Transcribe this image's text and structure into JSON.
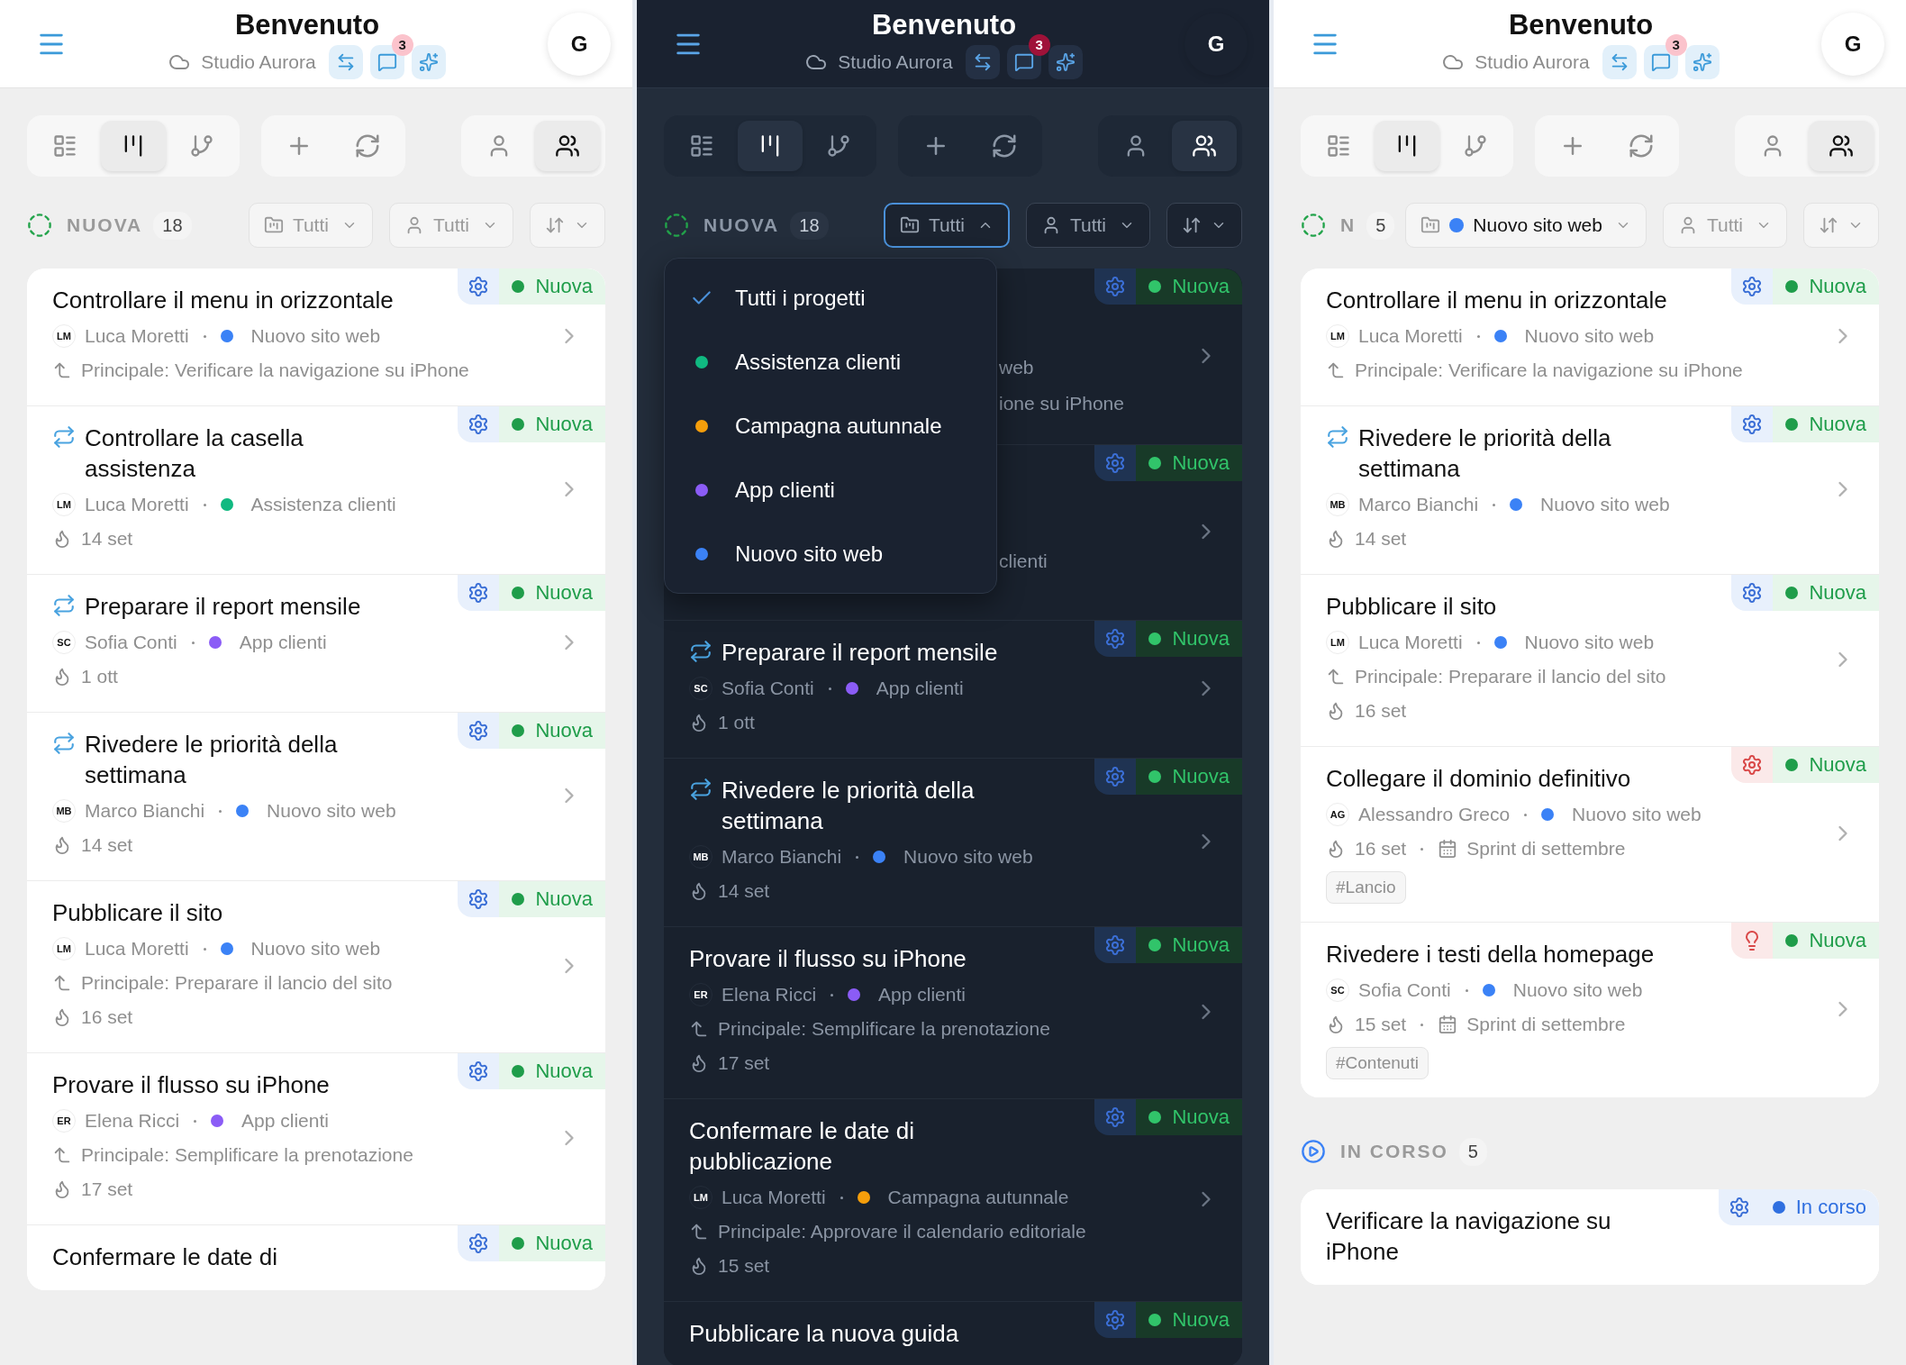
{
  "panels": [
    {
      "kind": "light",
      "header": {
        "title": "Benvenuto",
        "workspace": "Studio Aurora",
        "badge": "3",
        "avatar": "G"
      },
      "toolbar": {
        "views": [
          {
            "kind": "list",
            "selected": false
          },
          {
            "kind": "board",
            "selected": true
          },
          {
            "kind": "branch",
            "selected": false
          }
        ],
        "actions": [
          {
            "kind": "add"
          },
          {
            "kind": "refresh"
          }
        ],
        "scopes": [
          {
            "kind": "me",
            "selected": false
          },
          {
            "kind": "team",
            "selected": true
          }
        ]
      },
      "filters": {
        "project": {
          "label": "Tutti",
          "open": false
        },
        "assignee": {
          "label": "Tutti"
        }
      },
      "sections": [
        {
          "kind": "new",
          "label": "NUOVA",
          "count": "18",
          "cards": [
            {
              "kind": "task",
              "title": "Controllare il menu in orizzontale",
              "recurring": false,
              "initials": "LM",
              "assignee": "Luca Moretti",
              "project": "Nuovo sito web",
              "color": "#3b82f6",
              "parent": "Principale: Verificare la navigazione su iPhone",
              "type": {
                "kind": "gear",
                "urgent": false
              },
              "status": "Nuova"
            },
            {
              "kind": "task",
              "title": "Controllare la casella assistenza",
              "recurring": true,
              "initials": "LM",
              "assignee": "Luca Moretti",
              "project": "Assistenza clienti",
              "color": "#10b981",
              "due": "14 set",
              "type": {
                "kind": "gear",
                "urgent": false
              },
              "status": "Nuova"
            },
            {
              "kind": "task",
              "title": "Preparare il report mensile",
              "recurring": true,
              "initials": "SC",
              "assignee": "Sofia Conti",
              "project": "App clienti",
              "color": "#8b5cf6",
              "due": "1 ott",
              "type": {
                "kind": "gear",
                "urgent": false
              },
              "status": "Nuova"
            },
            {
              "kind": "task",
              "title": "Rivedere le priorità della settimana",
              "recurring": true,
              "initials": "MB",
              "assignee": "Marco Bianchi",
              "project": "Nuovo sito web",
              "color": "#3b82f6",
              "due": "14 set",
              "type": {
                "kind": "gear",
                "urgent": false
              },
              "status": "Nuova"
            },
            {
              "kind": "task",
              "title": "Pubblicare il sito",
              "recurring": false,
              "initials": "LM",
              "assignee": "Luca Moretti",
              "project": "Nuovo sito web",
              "color": "#3b82f6",
              "parent": "Principale: Preparare il lancio del sito",
              "due": "16 set",
              "type": {
                "kind": "gear",
                "urgent": false
              },
              "status": "Nuova"
            },
            {
              "kind": "task",
              "title": "Provare il flusso su iPhone",
              "recurring": false,
              "initials": "ER",
              "assignee": "Elena Ricci",
              "project": "App clienti",
              "color": "#8b5cf6",
              "parent": "Principale: Semplificare la prenotazione",
              "due": "17 set",
              "type": {
                "kind": "gear",
                "urgent": false
              },
              "status": "Nuova"
            },
            {
              "kind": "task",
              "title": "Confermare le date di",
              "recurring": false,
              "type": {
                "kind": "gear",
                "urgent": false
              },
              "status": "Nuova"
            }
          ]
        }
      ]
    },
    {
      "kind": "dark",
      "header": {
        "title": "Benvenuto",
        "workspace": "Studio Aurora",
        "badge": "3",
        "avatar": "G"
      },
      "toolbar": {
        "views": [
          {
            "kind": "list",
            "selected": false
          },
          {
            "kind": "board",
            "selected": true
          },
          {
            "kind": "branch",
            "selected": false
          }
        ],
        "actions": [
          {
            "kind": "add"
          },
          {
            "kind": "refresh"
          }
        ],
        "scopes": [
          {
            "kind": "me",
            "selected": false
          },
          {
            "kind": "team",
            "selected": true
          }
        ]
      },
      "filters": {
        "project": {
          "label": "Tutti",
          "open": true
        },
        "assignee": {
          "label": "Tutti"
        }
      },
      "project_menu": [
        {
          "label": "Tutti i progetti",
          "selected": true
        },
        {
          "label": "Assistenza clienti",
          "color": "#10b981",
          "selected": false
        },
        {
          "label": "Campagna autunnale",
          "color": "#f59e0b",
          "selected": false
        },
        {
          "label": "App clienti",
          "color": "#8b5cf6",
          "selected": false
        },
        {
          "label": "Nuovo sito web",
          "color": "#3b82f6",
          "selected": false
        }
      ],
      "sections": [
        {
          "kind": "new",
          "label": "NUOVA",
          "count": "18",
          "cards": [
            {
              "kind": "covered",
              "fragments": [
                "web",
                "ione su iPhone"
              ],
              "type": {
                "kind": "gear",
                "urgent": false
              },
              "status": "Nuova"
            },
            {
              "kind": "covered",
              "fragments": [
                "clienti"
              ],
              "type": {
                "kind": "gear",
                "urgent": false
              },
              "status": "Nuova"
            },
            {
              "kind": "task",
              "title": "Preparare il report mensile",
              "recurring": true,
              "initials": "SC",
              "assignee": "Sofia Conti",
              "project": "App clienti",
              "color": "#8b5cf6",
              "due": "1 ott",
              "type": {
                "kind": "gear",
                "urgent": false
              },
              "status": "Nuova"
            },
            {
              "kind": "task",
              "title": "Rivedere le priorità della settimana",
              "recurring": true,
              "initials": "MB",
              "assignee": "Marco Bianchi",
              "project": "Nuovo sito web",
              "color": "#3b82f6",
              "due": "14 set",
              "type": {
                "kind": "gear",
                "urgent": false
              },
              "status": "Nuova"
            },
            {
              "kind": "task",
              "title": "Provare il flusso su iPhone",
              "recurring": false,
              "initials": "ER",
              "assignee": "Elena Ricci",
              "project": "App clienti",
              "color": "#8b5cf6",
              "parent": "Principale: Semplificare la prenotazione",
              "due": "17 set",
              "type": {
                "kind": "gear",
                "urgent": false
              },
              "status": "Nuova"
            },
            {
              "kind": "task",
              "title": "Confermare le date di pubblicazione",
              "recurring": false,
              "initials": "LM",
              "assignee": "Luca Moretti",
              "project": "Campagna autunnale",
              "color": "#f59e0b",
              "parent": "Principale: Approvare il calendario editoriale",
              "due": "15 set",
              "type": {
                "kind": "gear",
                "urgent": false
              },
              "status": "Nuova"
            },
            {
              "kind": "task",
              "title": "Pubblicare la nuova guida",
              "recurring": false,
              "type": {
                "kind": "gear",
                "urgent": false
              },
              "status": "Nuova"
            }
          ]
        }
      ]
    },
    {
      "kind": "light",
      "header": {
        "title": "Benvenuto",
        "workspace": "Studio Aurora",
        "badge": "3",
        "avatar": "G"
      },
      "toolbar": {
        "views": [
          {
            "kind": "list",
            "selected": false
          },
          {
            "kind": "board",
            "selected": true
          },
          {
            "kind": "branch",
            "selected": false
          }
        ],
        "actions": [
          {
            "kind": "add"
          },
          {
            "kind": "refresh"
          }
        ],
        "scopes": [
          {
            "kind": "me",
            "selected": false
          },
          {
            "kind": "team",
            "selected": true
          }
        ]
      },
      "filters": {
        "project": {
          "label": "Nuovo sito web",
          "color": "#3b82f6",
          "open": false
        },
        "assignee": {
          "label": "Tutti"
        }
      },
      "sections": [
        {
          "kind": "new",
          "label": "N",
          "count": "5",
          "cards": [
            {
              "kind": "task",
              "title": "Controllare il menu in orizzontale",
              "recurring": false,
              "initials": "LM",
              "assignee": "Luca Moretti",
              "project": "Nuovo sito web",
              "color": "#3b82f6",
              "parent": "Principale: Verificare la navigazione su iPhone",
              "type": {
                "kind": "gear",
                "urgent": false
              },
              "status": "Nuova"
            },
            {
              "kind": "task",
              "title": "Rivedere le priorità della settimana",
              "recurring": true,
              "initials": "MB",
              "assignee": "Marco Bianchi",
              "project": "Nuovo sito web",
              "color": "#3b82f6",
              "due": "14 set",
              "type": {
                "kind": "gear",
                "urgent": false
              },
              "status": "Nuova"
            },
            {
              "kind": "task",
              "title": "Pubblicare il sito",
              "recurring": false,
              "initials": "LM",
              "assignee": "Luca Moretti",
              "project": "Nuovo sito web",
              "color": "#3b82f6",
              "parent": "Principale: Preparare il lancio del sito",
              "due": "16 set",
              "type": {
                "kind": "gear",
                "urgent": false
              },
              "status": "Nuova"
            },
            {
              "kind": "task",
              "title": "Collegare il dominio definitivo",
              "recurring": false,
              "initials": "AG",
              "assignee": "Alessandro Greco",
              "project": "Nuovo sito web",
              "color": "#3b82f6",
              "due": "16 set",
              "sprint": "Sprint di settembre",
              "tag": "#Lancio",
              "type": {
                "kind": "gear",
                "urgent": true
              },
              "status": "Nuova"
            },
            {
              "kind": "task",
              "title": "Rivedere i testi della homepage",
              "recurring": false,
              "initials": "SC",
              "assignee": "Sofia Conti",
              "project": "Nuovo sito web",
              "color": "#3b82f6",
              "due": "15 set",
              "sprint": "Sprint di settembre",
              "tag": "#Contenuti",
              "type": {
                "kind": "bulb",
                "urgent": true
              },
              "status": "Nuova"
            }
          ]
        },
        {
          "kind": "in_progress",
          "label": "IN CORSO",
          "count": "5",
          "cards": [
            {
              "kind": "task",
              "title": "Verificare la navigazione su iPhone",
              "recurring": false,
              "type": {
                "kind": "gear",
                "urgent": false
              },
              "status": "In corso"
            }
          ]
        }
      ]
    }
  ]
}
